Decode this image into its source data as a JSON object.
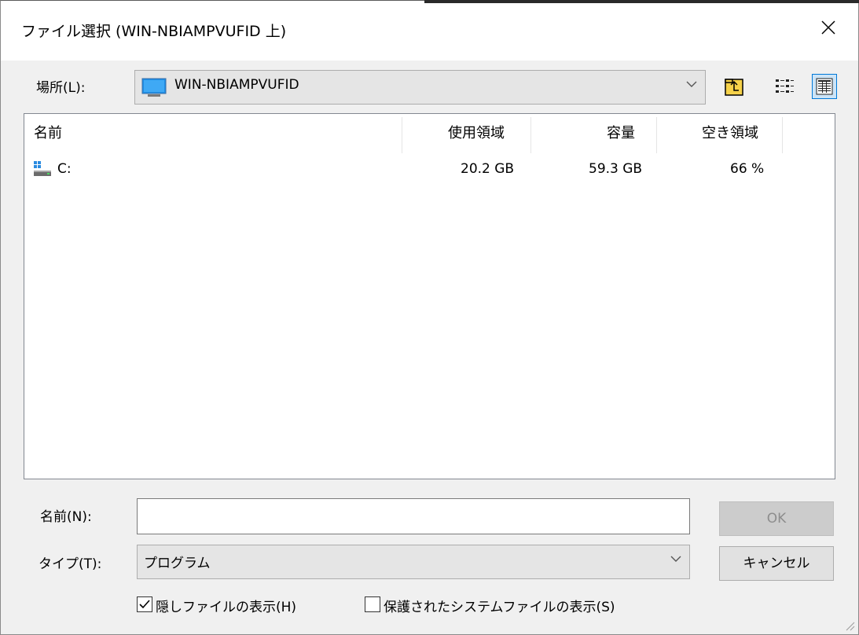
{
  "window": {
    "title": "ファイル選択 (WIN-NBIAMPVUFID 上)",
    "close_icon": "close-icon"
  },
  "location": {
    "label": "場所(L):",
    "value": "WIN-NBIAMPVUFID",
    "icon": "computer-icon",
    "toolbar": [
      {
        "name": "up-folder-button",
        "icon": "up-folder-icon"
      },
      {
        "name": "list-view-button",
        "icon": "list-view-icon"
      },
      {
        "name": "details-view-button",
        "icon": "details-view-icon",
        "active": true
      }
    ]
  },
  "list": {
    "columns": [
      "名前",
      "使用領域",
      "容量",
      "空き領域"
    ],
    "rows": [
      {
        "icon": "drive-icon",
        "name": "C:",
        "used": "20.2 GB",
        "capacity": "59.3 GB",
        "free": "66 %"
      }
    ]
  },
  "name_field": {
    "label": "名前(N):",
    "value": ""
  },
  "type_field": {
    "label": "タイプ(T):",
    "value": "プログラム"
  },
  "buttons": {
    "ok": "OK",
    "cancel": "キャンセル"
  },
  "options": {
    "show_hidden": {
      "label": "隠しファイルの表示(H)",
      "checked": true
    },
    "show_system": {
      "label": "保護されたシステムファイルの表示(S)",
      "checked": false
    }
  },
  "colors": {
    "accent": "#0078d7",
    "background": "#f0f0f0",
    "folder_yellow": "#f6d24a"
  }
}
